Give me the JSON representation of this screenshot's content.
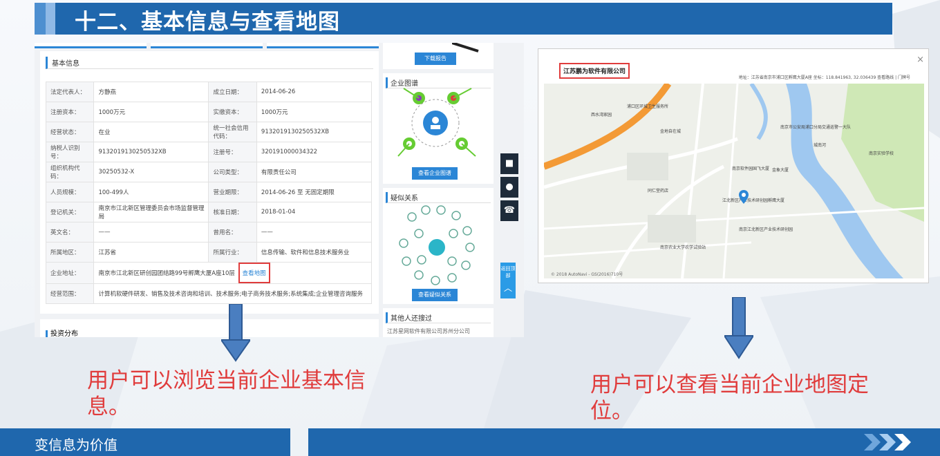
{
  "slide": {
    "title": "十二、基本信息与查看地图",
    "caption_left": "用户可以浏览当前企业基本信息。",
    "caption_right": "用户可以查看当前企业地图定位。",
    "footer": "变信息为价值"
  },
  "left_screenshot": {
    "basic_info_heading": "基本信息",
    "rows": [
      {
        "k1": "法定代表人：",
        "v1": "方静燕",
        "k2": "成立日期：",
        "v2": "2014-06-26"
      },
      {
        "k1": "注册资本：",
        "v1": "1000万元",
        "k2": "实缴资本：",
        "v2": "1000万元"
      },
      {
        "k1": "经营状态：",
        "v1": "在业",
        "k2": "统一社会信用代码：",
        "v2": "913201913025053​2XB"
      },
      {
        "k1": "纳税人识别号：",
        "v1": "913201913025053​2XB",
        "k2": "注册号：",
        "v2": "320191000034322"
      },
      {
        "k1": "组织机构代码：",
        "v1": "30250532-X",
        "k2": "公司类型：",
        "v2": "有限责任公司"
      },
      {
        "k1": "人员规模：",
        "v1": "100-499人",
        "k2": "营业期限：",
        "v2": "2014-06-26 至 无固定期限"
      },
      {
        "k1": "登记机关：",
        "v1": "南京市江北新区管理委员会市场监督管理局",
        "k2": "核准日期：",
        "v2": "2018-01-04"
      },
      {
        "k1": "英文名：",
        "v1": "——",
        "k2": "曾用名：",
        "v2": "——"
      },
      {
        "k1": "所属地区：",
        "v1": "江苏省",
        "k2": "所属行业：",
        "v2": "信息传输、软件和信息技术服务业"
      }
    ],
    "address_label": "企业地址：",
    "address_value": "南京市江北新区研创园团结路99号孵鹰大厦A座10层",
    "map_link": "查看地图",
    "scope_label": "经营范围：",
    "scope_value": "计算机软硬件研发、销售及技术咨询和培训、技术服务;电子商务技术服务;系统集成;企业管理咨询服务",
    "invest_heading": "投资分布",
    "download_button": "下载报告",
    "graph_heading": "企业图谱",
    "graph_button": "查看企业图谱",
    "relation_heading": "疑似关系",
    "relation_button": "查看疑似关系",
    "others_heading": "其他人还搜过",
    "others_item": "江苏星网软件有限公司苏州分公司",
    "float_top_label": "返回顶部"
  },
  "right_screenshot": {
    "company_name": "江苏鹏为软件有限公司",
    "address_line": "地址：江苏省南京市浦口区孵鹰大厦A座  坐标：118.841963, 32.036439  查看路线 | 门牌号",
    "close_symbol": "×",
    "map_labels": [
      "浦口区环城卫生服务所",
      "西水湾家园",
      "南京软件园国飞大厦",
      "江北新区产业技术研创园孵鹰大厦",
      "南京江北新区产业技术研创园",
      "金地自在城",
      "南京农业大学农学试验站",
      "南京市公安局浦口分局交通巡警一大队",
      "金象大厦",
      "城南河",
      "南京实验学校",
      "同仁堂药店"
    ],
    "map_copyright": "© 2018 AutoNavi - GS(2016)710号",
    "marker_icon": "map-pin-icon"
  },
  "colors": {
    "brand_blue": "#1f67ad",
    "accent_red": "#e03c3c",
    "link_blue": "#2b86d6"
  }
}
